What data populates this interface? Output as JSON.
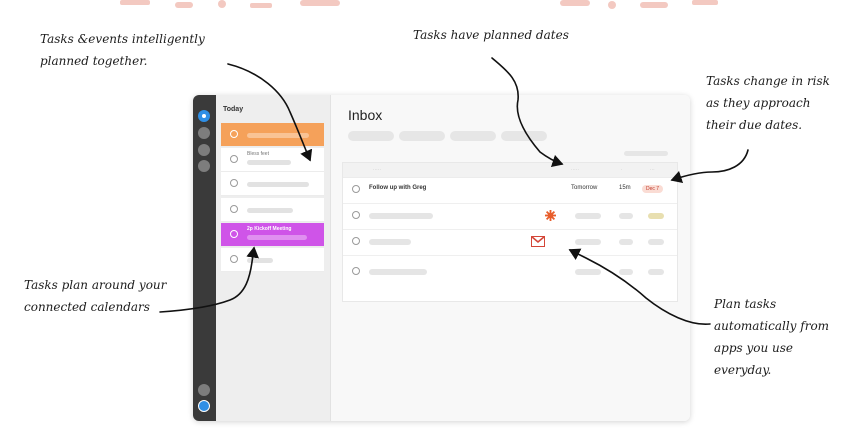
{
  "annotations": {
    "events_line1": "Tasks &events intelligently",
    "events_line2": "planned together.",
    "dates": "Tasks have planned dates",
    "risk_line1": "Tasks change in risk",
    "risk_line2": "as they approach",
    "risk_line3": "their due dates.",
    "calendars_line1": "Tasks plan around your",
    "calendars_line2": "connected calendars",
    "apps_line1": "Plan tasks",
    "apps_line2": "automatically from",
    "apps_line3": "apps you use everyday."
  },
  "sidebar": {
    "day_title": "Today"
  },
  "slots": {
    "slot2_label": "Bless feet",
    "event_label": "2p  Kickoff Meeting"
  },
  "inbox": {
    "title": "Inbox",
    "row1": {
      "title": "Follow up with Greg",
      "planned": "Tomorrow",
      "estimate": "15m",
      "due": "Dec 7"
    }
  },
  "colors": {
    "accent_orange": "#f5a15a",
    "accent_purple": "#cf54e8",
    "rail": "#3a3a3a",
    "rail_active": "#2f8fe6"
  },
  "icons": {
    "asana": "asana-icon",
    "gmail": "gmail-icon"
  }
}
